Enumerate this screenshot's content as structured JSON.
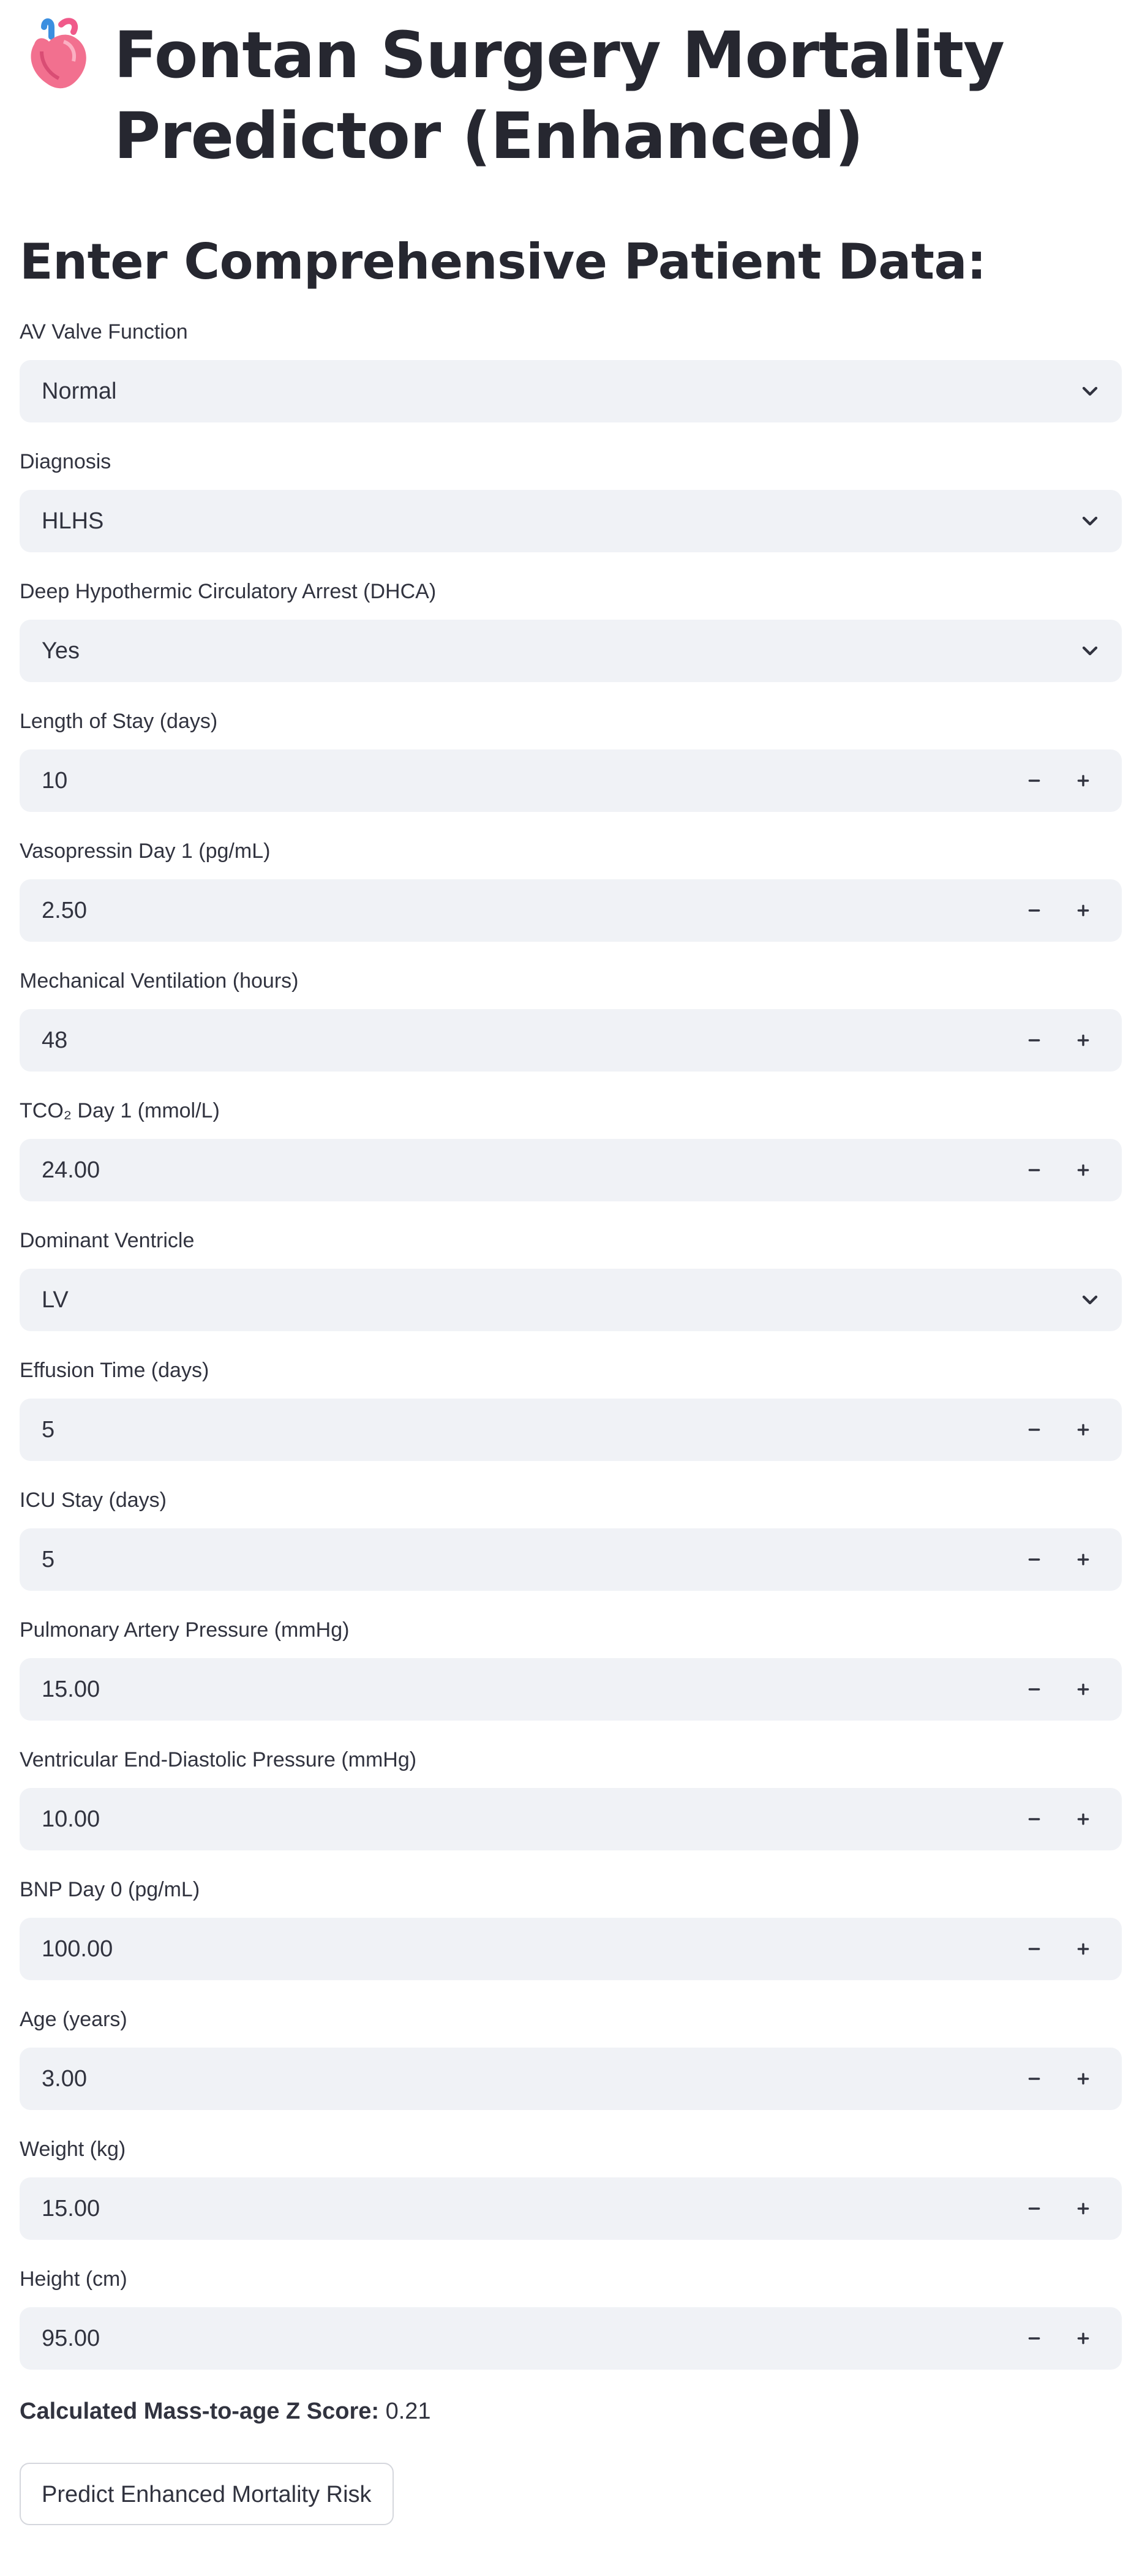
{
  "header": {
    "title": "Fontan Surgery Mortality Predictor (Enhanced)",
    "icon": "anatomical-heart-icon",
    "subheader": "Enter Comprehensive Patient Data:"
  },
  "fields": [
    {
      "label": "AV Valve Function",
      "value": "Normal",
      "kind": "select"
    },
    {
      "label": "Diagnosis",
      "value": "HLHS",
      "kind": "select"
    },
    {
      "label": "Deep Hypothermic Circulatory Arrest (DHCA)",
      "value": "Yes",
      "kind": "select"
    },
    {
      "label": "Length of Stay (days)",
      "value": "10",
      "kind": "number"
    },
    {
      "label": "Vasopressin Day 1 (pg/mL)",
      "value": "2.50",
      "kind": "number"
    },
    {
      "label": "Mechanical Ventilation (hours)",
      "value": "48",
      "kind": "number"
    },
    {
      "label": "TCO₂ Day 1 (mmol/L)",
      "value": "24.00",
      "kind": "number"
    },
    {
      "label": "Dominant Ventricle",
      "value": "LV",
      "kind": "select"
    },
    {
      "label": "Effusion Time (days)",
      "value": "5",
      "kind": "number"
    },
    {
      "label": "ICU Stay (days)",
      "value": "5",
      "kind": "number"
    },
    {
      "label": "Pulmonary Artery Pressure (mmHg)",
      "value": "15.00",
      "kind": "number"
    },
    {
      "label": "Ventricular End-Diastolic Pressure (mmHg)",
      "value": "10.00",
      "kind": "number"
    },
    {
      "label": "BNP Day 0 (pg/mL)",
      "value": "100.00",
      "kind": "number"
    },
    {
      "label": "Age (years)",
      "value": "3.00",
      "kind": "number"
    },
    {
      "label": "Weight (kg)",
      "value": "15.00",
      "kind": "number"
    },
    {
      "label": "Height (cm)",
      "value": "95.00",
      "kind": "number"
    }
  ],
  "result": {
    "label": "Calculated Mass-to-age Z Score:",
    "value": "0.21"
  },
  "actions": {
    "predict_label": "Predict Enhanced Mortality Risk"
  }
}
